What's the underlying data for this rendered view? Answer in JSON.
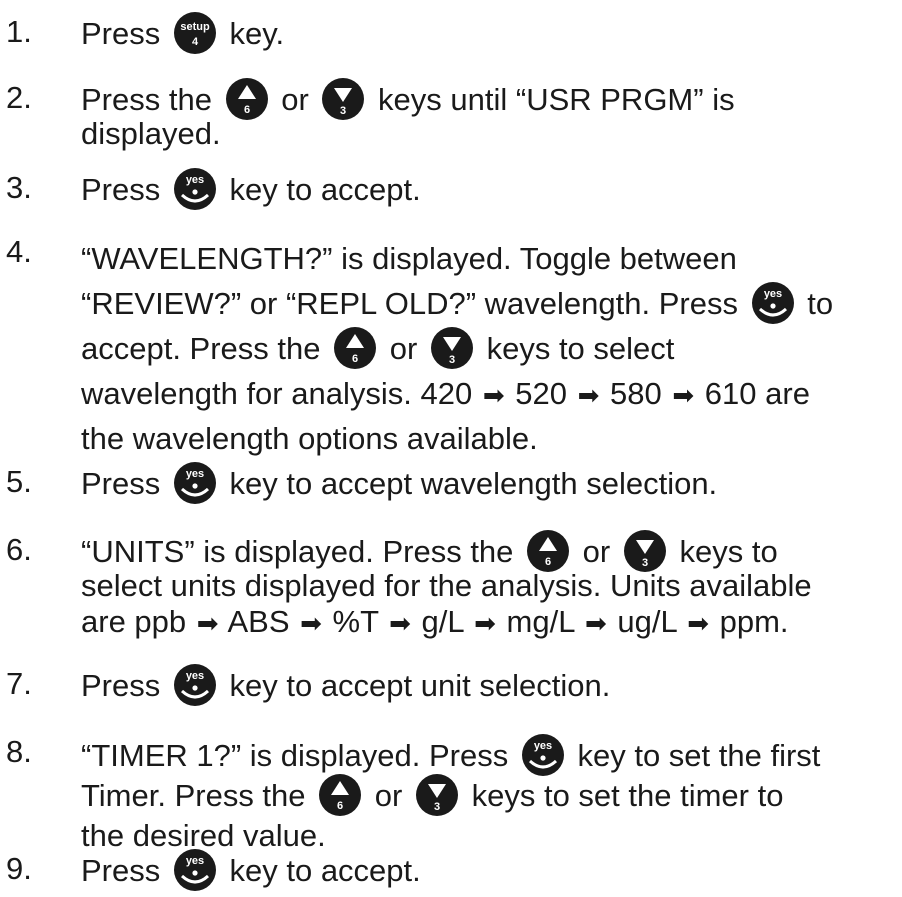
{
  "keys": {
    "setup": "setup",
    "setup_num": "4",
    "up_num": "6",
    "down_num": "3",
    "yes": "yes"
  },
  "arrow": "➡",
  "steps": [
    {
      "num": "1.",
      "t": [
        "Press",
        "key."
      ]
    },
    {
      "num": "2.",
      "t": [
        "Press the",
        "or",
        "keys until “USR PRGM” is",
        "displayed."
      ]
    },
    {
      "num": "3.",
      "t": [
        "Press",
        "key to accept."
      ]
    },
    {
      "num": "4.",
      "t": [
        "“WAVELENGTH?” is displayed.  Toggle between",
        "“REVIEW?” or “REPL OLD?” wavelength.  Press",
        "to",
        "accept.  Press the",
        "or",
        "keys to select",
        "wavelength for analysis.  420",
        "520",
        "580",
        "610 are",
        "the wavelength options available."
      ]
    },
    {
      "num": "5.",
      "t": [
        "Press",
        "key to accept wavelength selection."
      ]
    },
    {
      "num": "6.",
      "t": [
        "“UNITS” is displayed.  Press the",
        "or",
        "keys to",
        "select units displayed for the analysis.  Units available",
        "are ppb",
        "ABS",
        "%T",
        "g/L",
        "mg/L",
        "ug/L",
        "ppm."
      ]
    },
    {
      "num": "7.",
      "t": [
        "Press",
        "key to accept unit selection."
      ]
    },
    {
      "num": "8.",
      "t": [
        "“TIMER 1?” is displayed.  Press",
        "key to set the first",
        "Timer. Press the",
        "or",
        "keys to set the timer to",
        "the desired value."
      ]
    },
    {
      "num": "9.",
      "t": [
        "Press",
        "key to accept."
      ]
    }
  ]
}
